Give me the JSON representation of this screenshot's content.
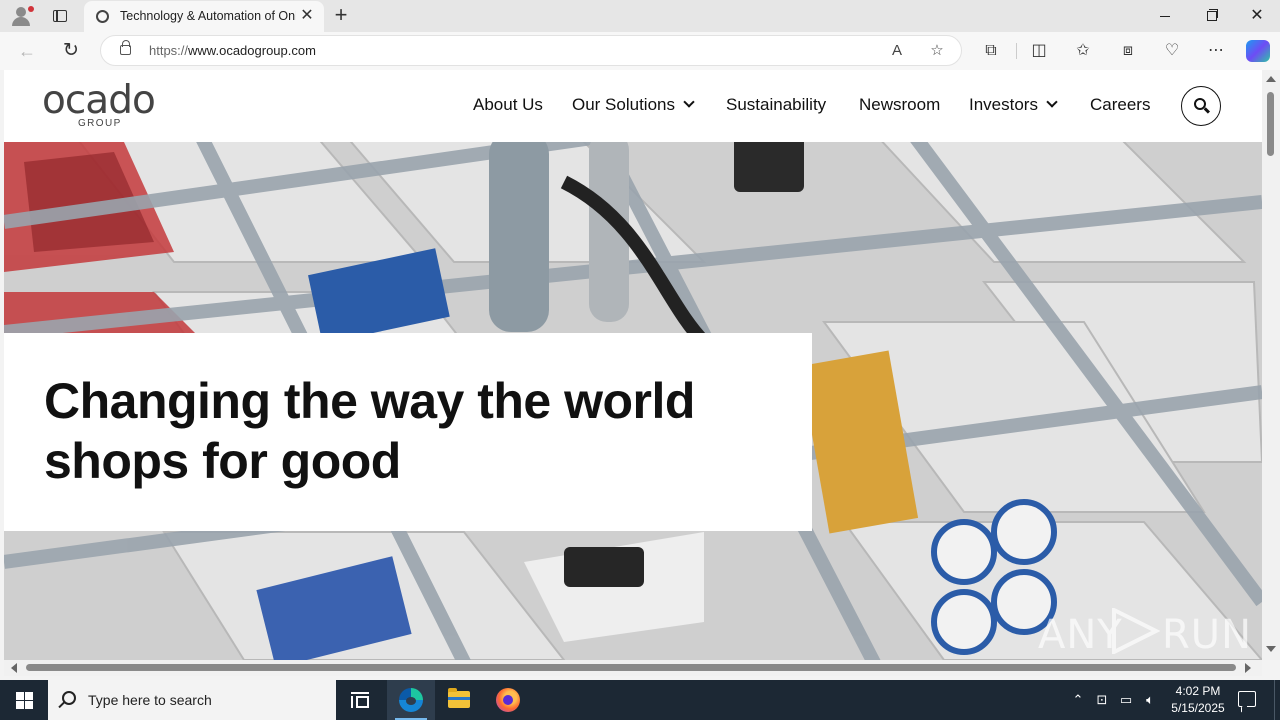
{
  "browser": {
    "tab_title": "Technology & Automation of Online Grocery",
    "tab_close": "✕",
    "new_tab": "+",
    "url_protocol": "https://",
    "url_host": "www.ocadogroup.com"
  },
  "site": {
    "logo_word": "ocado",
    "logo_sub": "GROUP",
    "nav": [
      {
        "label": "About Us"
      },
      {
        "label": "Our Solutions"
      },
      {
        "label": "Sustainability"
      },
      {
        "label": "Newsroom"
      },
      {
        "label": "Investors"
      },
      {
        "label": "Careers"
      }
    ],
    "hero_heading": "Changing the way the world shops for good"
  },
  "watermark": {
    "left": "ANY",
    "right": "RUN"
  },
  "taskbar": {
    "search_placeholder": "Type here to search",
    "time": "4:02 PM",
    "date": "5/15/2025"
  }
}
